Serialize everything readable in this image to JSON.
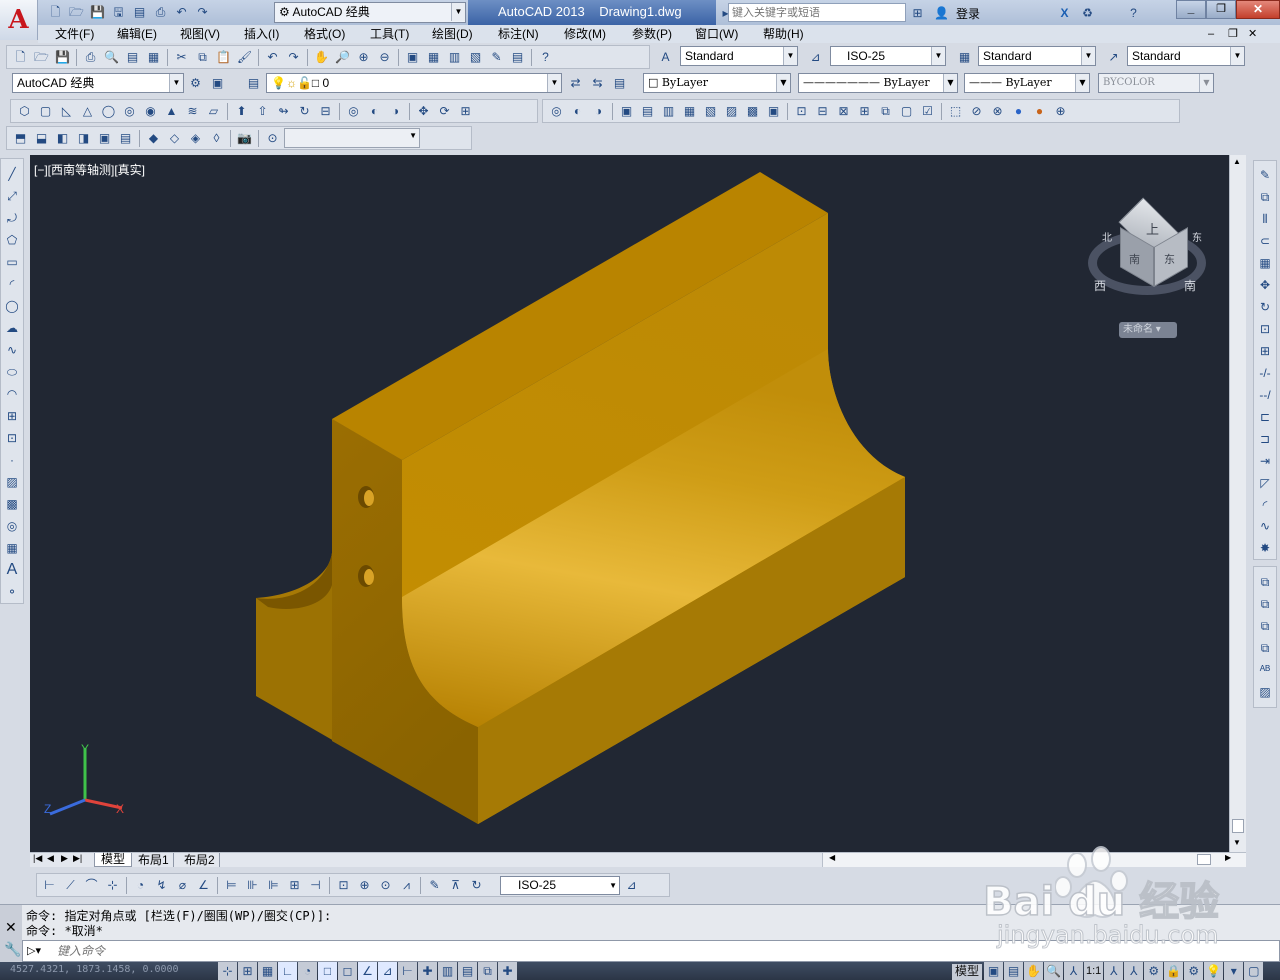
{
  "title_bar": {
    "workspace": "AutoCAD 经典",
    "app_name": "AutoCAD 2013",
    "doc_name": "Drawing1.dwg",
    "search_placeholder": "键入关键字或短语",
    "login": "登录"
  },
  "menu": [
    "文件(F)",
    "编辑(E)",
    "视图(V)",
    "插入(I)",
    "格式(O)",
    "工具(T)",
    "绘图(D)",
    "标注(N)",
    "修改(M)",
    "参数(P)",
    "窗口(W)",
    "帮助(H)"
  ],
  "styles": {
    "text_style": "Standard",
    "dim_style": "ISO-25",
    "table_style": "Standard",
    "mleader_style": "Standard"
  },
  "layers": {
    "workspace": "AutoCAD 经典",
    "layer": "0",
    "color": "ByLayer",
    "linetype": "ByLayer",
    "lineweight": "ByLayer",
    "plotstyle": "BYCOLOR"
  },
  "viewport": {
    "label": "[−][西南等轴测][真实]",
    "bg": "#212733",
    "solid_color": "#c99a10"
  },
  "viewcube": {
    "face_top": "上",
    "face_front": "南",
    "face_right": "东",
    "compass_w": "西",
    "compass_s": "南",
    "compass_e": "东",
    "compass_n": "北",
    "ucs_menu": "未命名"
  },
  "ucs": {
    "x": "X",
    "y": "Y",
    "z": "Z"
  },
  "tabs": [
    "模型",
    "布局1",
    "布局2"
  ],
  "dim_toolbar": {
    "style": "ISO-25"
  },
  "command": {
    "line1": "命令: 指定对角点或 [栏选(F)/圈围(WP)/圈交(CP)]:",
    "line2": "命令: *取消*",
    "placeholder": "键入命令"
  },
  "status": {
    "coords": "4527.4321, 1873.1458, 0.0000",
    "mode": "模型",
    "scale": "1:1"
  },
  "watermark": {
    "brand": "Bai du 经验",
    "url": "jingyan.baidu.com"
  }
}
